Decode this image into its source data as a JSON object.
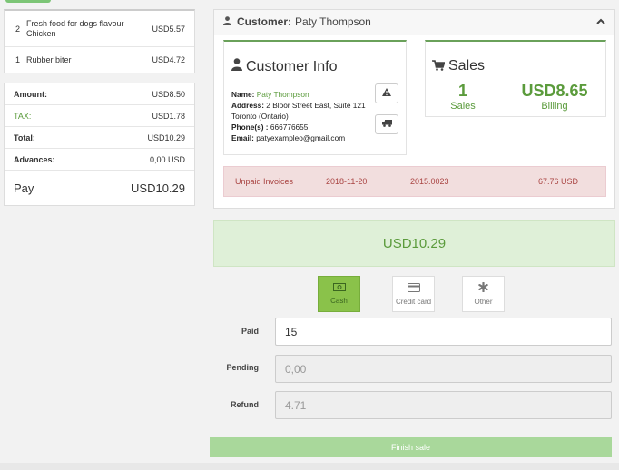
{
  "cart": {
    "items": [
      {
        "qty": "2",
        "name": "Fresh food for dogs flavour Chicken",
        "price": "USD5.57"
      },
      {
        "qty": "1",
        "name": "Rubber biter",
        "price": "USD4.72"
      }
    ]
  },
  "totals": {
    "amount_label": "Amount:",
    "amount": "USD8.50",
    "tax_label": "TAX:",
    "tax": "USD1.78",
    "total_label": "Total:",
    "total": "USD10.29",
    "advances_label": "Advances:",
    "advances": "0,00 USD",
    "pay_label": "Pay",
    "pay": "USD10.29"
  },
  "customer": {
    "header_label": "Customer:",
    "header_name": "Paty Thompson",
    "info_title": "Customer Info",
    "name_label": "Name:",
    "name": "Paty Thompson",
    "address_label": "Address:",
    "address": "2 Bloor Street East, Suite 121",
    "city": "Toronto (Ontario)",
    "phone_label": "Phone(s) :",
    "phone": "666776655",
    "email_label": "Email:",
    "email": "patyexampleo@gmail.com"
  },
  "sales": {
    "title": "Sales",
    "count": "1",
    "count_label": "Sales",
    "billing": "USD8.65",
    "billing_label": "Billing"
  },
  "unpaid": {
    "label": "Unpaid Invoices",
    "date": "2018-11-20",
    "number": "2015.0023",
    "amount": "67.76 USD"
  },
  "payment": {
    "total": "USD10.29",
    "methods": [
      {
        "label": "Cash",
        "icon": "cash-icon",
        "active": true
      },
      {
        "label": "Credit card",
        "icon": "credit-card-icon",
        "active": false
      },
      {
        "label": "Other",
        "icon": "asterisk-icon",
        "active": false
      }
    ],
    "paid_label": "Paid",
    "paid": "15",
    "pending_label": "Pending",
    "pending": "0,00",
    "refund_label": "Refund",
    "refund": "4.71",
    "finish_label": "Finish sale"
  },
  "colors": {
    "accent_green": "#5b9b3c",
    "active_method": "#8ac24a",
    "success_bg": "#dff0d8",
    "danger_bg": "#f2dede",
    "finish_button": "#a9d89b"
  }
}
